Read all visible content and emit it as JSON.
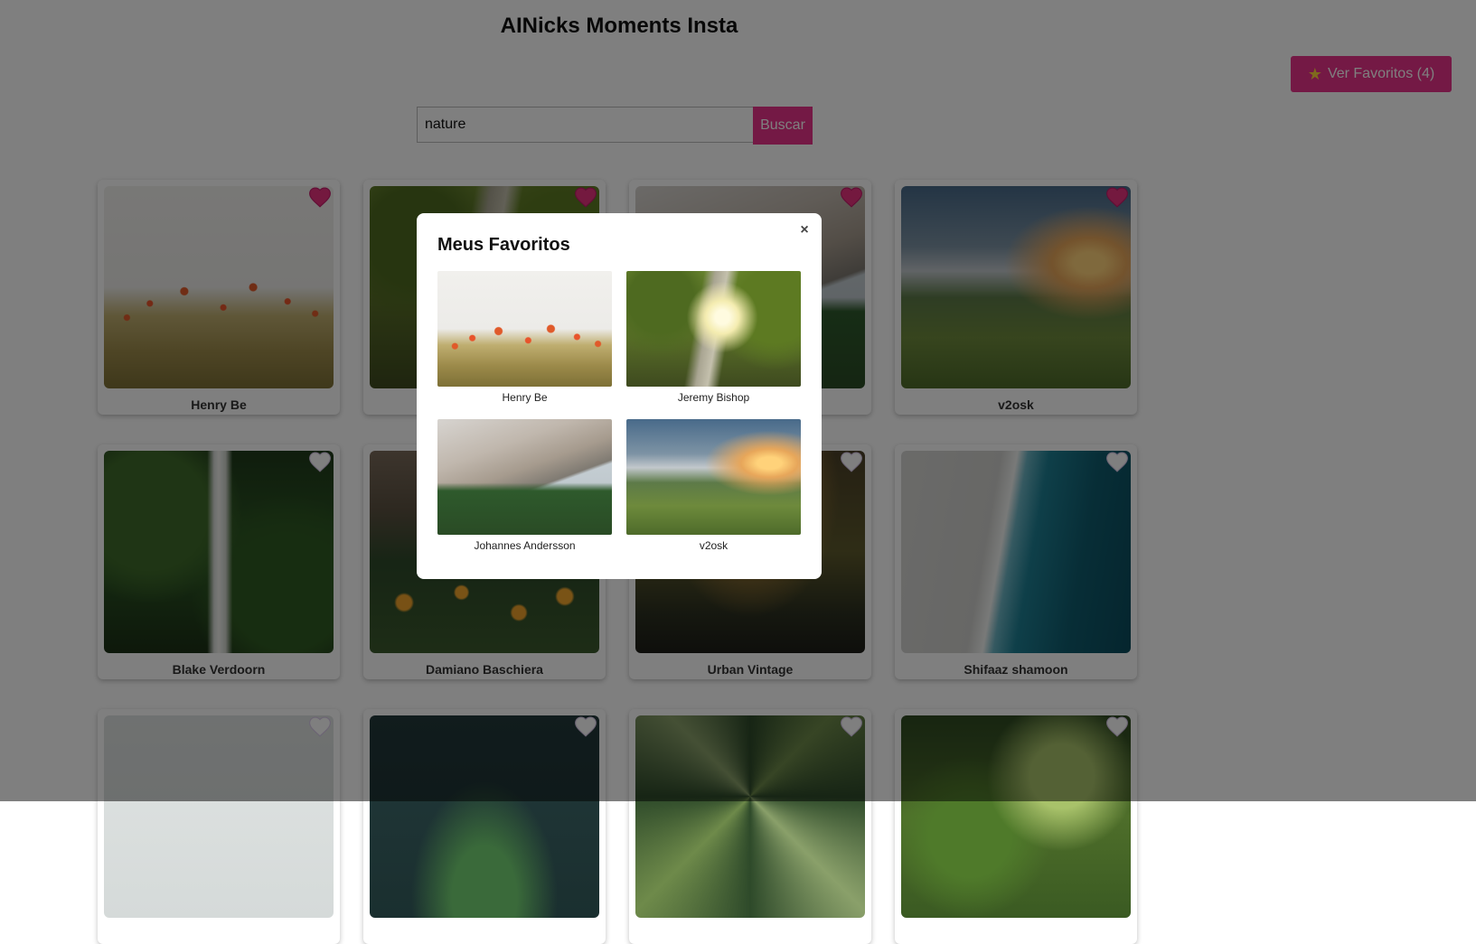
{
  "header": {
    "title": "AINicks Moments Insta"
  },
  "favorites_button": {
    "label": "Ver Favoritos (4)",
    "icon": "star-icon"
  },
  "search": {
    "value": "nature",
    "placeholder": "",
    "button_label": "Buscar"
  },
  "colors": {
    "accent": "#e8338a",
    "heart_filled": "#e8337f",
    "heart_empty": "#ffffff"
  },
  "cards": [
    {
      "author": "Henry Be",
      "favorited": true,
      "photo": "p-poppy"
    },
    {
      "author": "Jeremy Bishop",
      "favorited": true,
      "photo": "p-tree"
    },
    {
      "author": "Johannes Andersson",
      "favorited": true,
      "photo": "p-mountain"
    },
    {
      "author": "v2osk",
      "favorited": true,
      "photo": "p-valley"
    },
    {
      "author": "Blake Verdoorn",
      "favorited": false,
      "photo": "p-waterfall"
    },
    {
      "author": "Damiano Baschiera",
      "favorited": false,
      "photo": "p-flowers"
    },
    {
      "author": "Urban Vintage",
      "favorited": false,
      "photo": "p-urban"
    },
    {
      "author": "Shifaaz shamoon",
      "favorited": false,
      "photo": "p-ocean"
    },
    {
      "author": "",
      "favorited": false,
      "photo": "p-mist"
    },
    {
      "author": "",
      "favorited": false,
      "photo": "p-darkfern"
    },
    {
      "author": "",
      "favorited": false,
      "photo": "p-forestup"
    },
    {
      "author": "",
      "favorited": false,
      "photo": "p-leaves"
    }
  ],
  "modal": {
    "title": "Meus Favoritos",
    "close_label": "×",
    "items": [
      {
        "author": "Henry Be",
        "photo": "p-poppy"
      },
      {
        "author": "Jeremy Bishop",
        "photo": "p-tree"
      },
      {
        "author": "Johannes Andersson",
        "photo": "p-mountain"
      },
      {
        "author": "v2osk",
        "photo": "p-valley"
      }
    ]
  }
}
